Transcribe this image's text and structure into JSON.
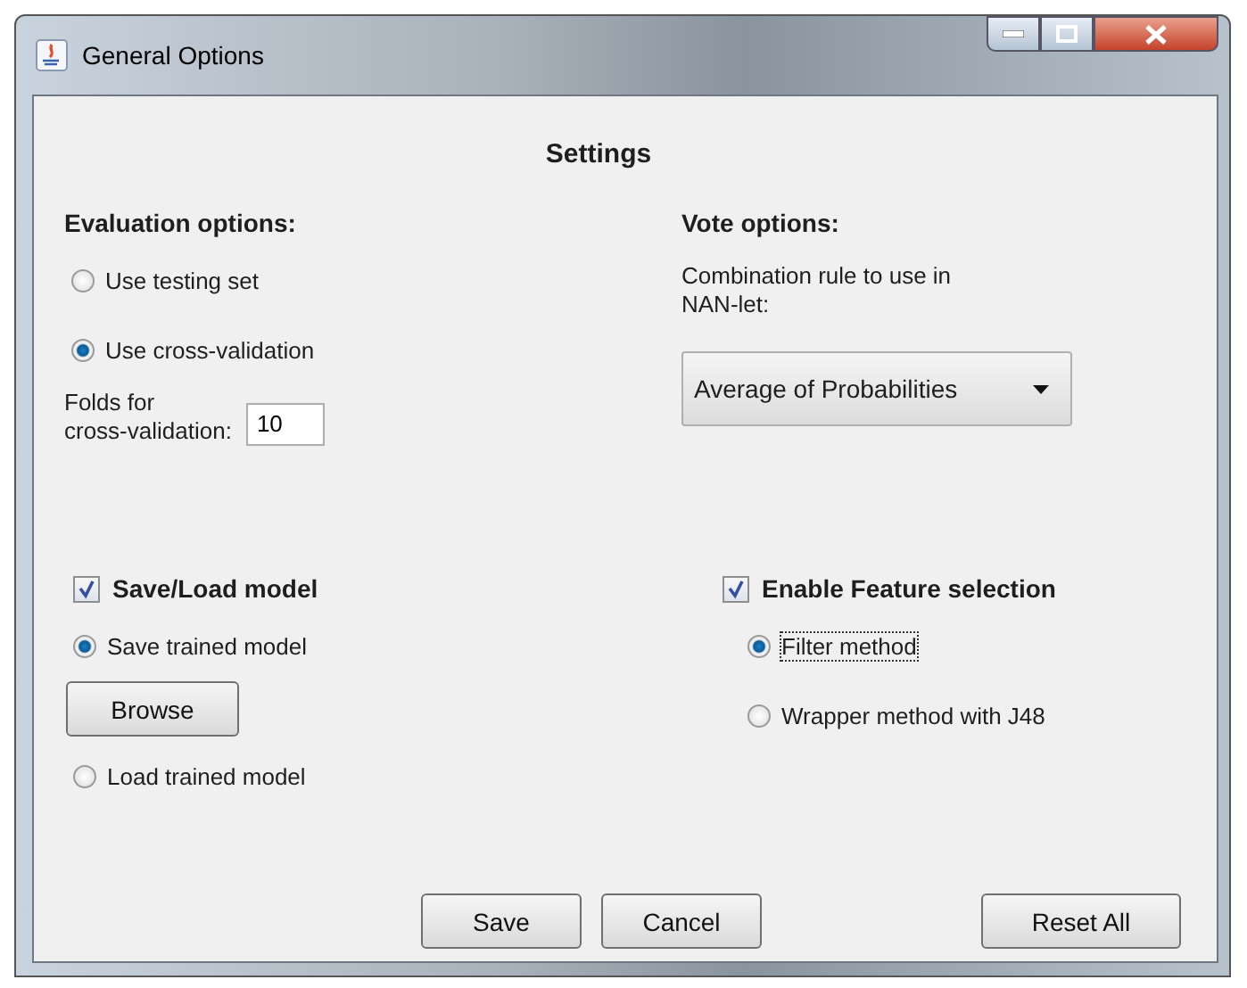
{
  "window": {
    "title": "General Options"
  },
  "heading": "Settings",
  "evaluation": {
    "title": "Evaluation options:",
    "options": [
      {
        "label": "Use testing set",
        "selected": false
      },
      {
        "label": "Use cross-validation",
        "selected": true
      }
    ],
    "folds_label": [
      "Folds for",
      "cross-validation:"
    ],
    "folds_value": "10"
  },
  "vote": {
    "title": "Vote options:",
    "description": [
      "Combination rule to use in",
      "NAN-let:"
    ],
    "rule": "Average of Probabilities"
  },
  "model": {
    "label": "Save/Load model",
    "checked": true,
    "options": [
      {
        "label": "Save trained model",
        "selected": true,
        "focused": false
      },
      {
        "label": "Load trained model",
        "selected": false,
        "focused": false
      }
    ],
    "browse": "Browse"
  },
  "feature": {
    "label": "Enable Feature selection",
    "checked": true,
    "options": [
      {
        "label": "Filter method",
        "selected": true,
        "focused": true
      },
      {
        "label": "Wrapper method with J48",
        "selected": false,
        "focused": false
      }
    ]
  },
  "buttons": [
    {
      "label": "Save",
      "kind": "left"
    },
    {
      "label": "Cancel",
      "kind": "left"
    },
    {
      "label": "Reset All",
      "kind": "right"
    }
  ]
}
